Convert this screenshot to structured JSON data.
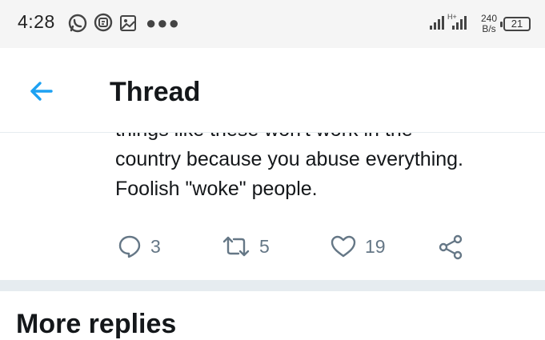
{
  "status_bar": {
    "time": "4:28",
    "net_speed_value": "240",
    "net_speed_unit": "B/s",
    "battery_level": "21",
    "network_type": "H+"
  },
  "header": {
    "title": "Thread"
  },
  "tweet": {
    "text_clipped_line": "things like these won't work in the",
    "text_lines": [
      "country because you abuse everything.",
      "Foolish \"woke\" people."
    ],
    "reply_count": "3",
    "retweet_count": "5",
    "like_count": "19"
  },
  "next_item": {
    "title_partial": "More replies"
  },
  "colors": {
    "accent": "#1da1f2",
    "action_gray": "#657786",
    "divider": "#e6ecf0",
    "status_bg": "#f5f5f5"
  },
  "icons": [
    "whatsapp-icon",
    "message-icon",
    "gallery-icon",
    "more-dots-icon",
    "signal-icon",
    "battery-icon",
    "back-arrow-icon",
    "reply-icon",
    "retweet-icon",
    "like-icon",
    "share-icon"
  ]
}
